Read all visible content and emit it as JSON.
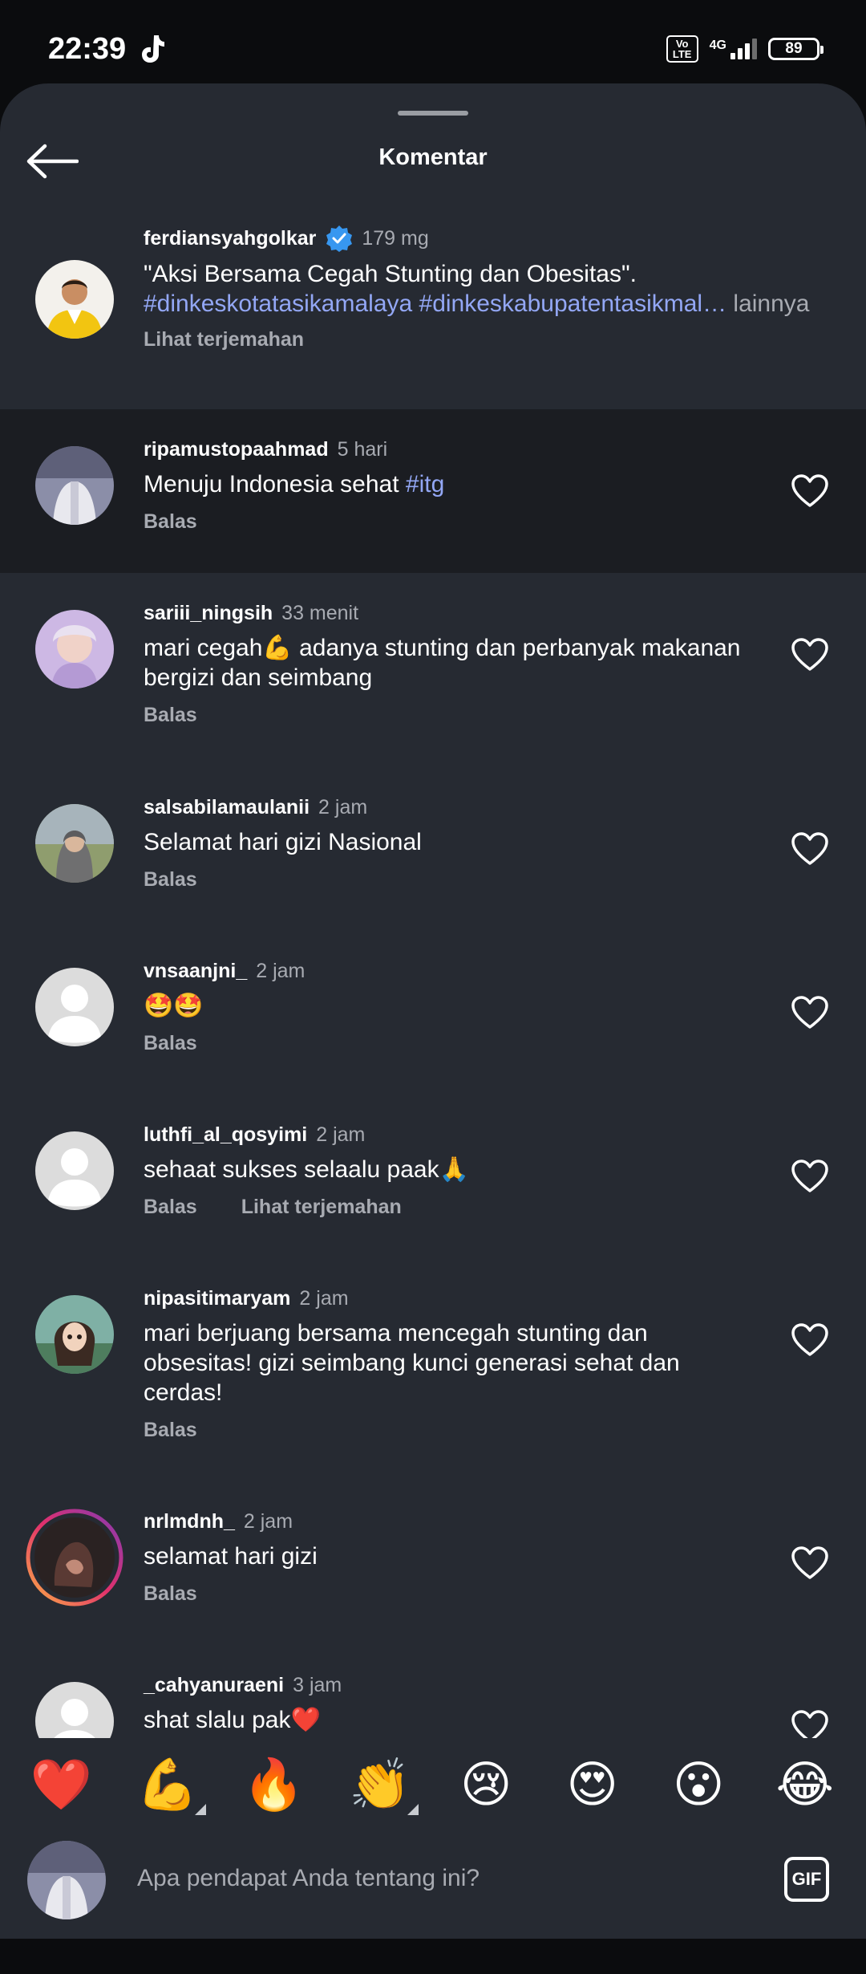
{
  "status_bar": {
    "time": "22:39",
    "volte": "Vo LTE",
    "network": "4G",
    "battery": "89"
  },
  "sheet": {
    "title": "Komentar"
  },
  "caption": {
    "username": "ferdiansyahgolkar",
    "time": "179 mg",
    "text": "\"Aksi Bersama Cegah Stunting dan Obesitas\".",
    "hashtags": "#dinkeskotatasikamalaya #dinkeskabupatentasikmal…",
    "more": "lainnya",
    "translate": "Lihat terjemahan"
  },
  "comments": [
    {
      "username": "ripamustopaahmad",
      "time": "5 hari",
      "text": "Menuju Indonesia sehat ",
      "hashtag": "#itg",
      "reply": "Balas"
    },
    {
      "username": "sariii_ningsih",
      "time": "33 menit",
      "text": "mari cegah💪 adanya stunting dan perbanyak makanan bergizi dan seimbang",
      "reply": "Balas"
    },
    {
      "username": "salsabilamaulanii",
      "time": "2 jam",
      "text": "Selamat hari gizi Nasional",
      "reply": "Balas"
    },
    {
      "username": "vnsaanjni_",
      "time": "2 jam",
      "text": "🤩🤩",
      "reply": "Balas"
    },
    {
      "username": "luthfi_al_qosyimi",
      "time": "2 jam",
      "text": "sehaat sukses selaalu paak🙏",
      "reply": "Balas",
      "translate": "Lihat terjemahan"
    },
    {
      "username": "nipasitimaryam",
      "time": "2 jam",
      "text": "mari berjuang bersama mencegah stunting dan obsesitas! gizi seimbang kunci generasi sehat dan cerdas!",
      "reply": "Balas"
    },
    {
      "username": "nrlmdnh_",
      "time": "2 jam",
      "text": "selamat hari gizi",
      "reply": "Balas"
    },
    {
      "username": "_cahyanuraeni",
      "time": "3 jam",
      "text": "shat slalu pak❤️"
    }
  ],
  "quick_emojis": [
    "❤️",
    "💪",
    "🔥",
    "👏",
    "😢",
    "😍",
    "😮",
    "😂"
  ],
  "input": {
    "placeholder": "Apa pendapat Anda tentang ini?",
    "gif_label": "GIF"
  },
  "colors": {
    "sheet_bg": "#262a32",
    "highlight_bg": "#1b1d22",
    "hashtag": "#93a7f5",
    "muted": "#a8abb2",
    "verified": "#3797f0"
  },
  "icons": [
    "back-arrow-icon",
    "verified-badge-icon",
    "heart-outline-icon",
    "gif-icon",
    "tiktok-icon",
    "battery-icon",
    "signal-icon"
  ]
}
